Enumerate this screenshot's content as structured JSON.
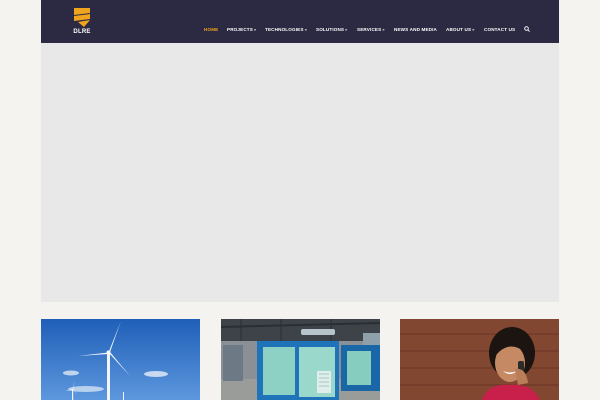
{
  "brand": {
    "name": "DLRE",
    "logo_color": "#f0a31d"
  },
  "header": {
    "background": "#2c2a42"
  },
  "nav": {
    "items": [
      {
        "label": "HOME",
        "active": true,
        "has_dropdown": false
      },
      {
        "label": "PROJECTS",
        "active": false,
        "has_dropdown": true
      },
      {
        "label": "TECHNOLOGIES",
        "active": false,
        "has_dropdown": true
      },
      {
        "label": "SOLUTIONS",
        "active": false,
        "has_dropdown": true
      },
      {
        "label": "SERVICES",
        "active": false,
        "has_dropdown": true
      },
      {
        "label": "NEWS AND MEDIA",
        "active": false,
        "has_dropdown": false
      },
      {
        "label": "ABOUT US",
        "active": false,
        "has_dropdown": true
      },
      {
        "label": "CONTACT US",
        "active": false,
        "has_dropdown": false
      }
    ],
    "dropdown_caret": "»",
    "search_icon": "search-icon",
    "active_color": "#f0a31d"
  },
  "hero": {
    "background": "#e8e8e8"
  },
  "thumbnails": [
    {
      "subject": "wind-turbines"
    },
    {
      "subject": "generators-warehouse"
    },
    {
      "subject": "woman-on-phone"
    }
  ]
}
